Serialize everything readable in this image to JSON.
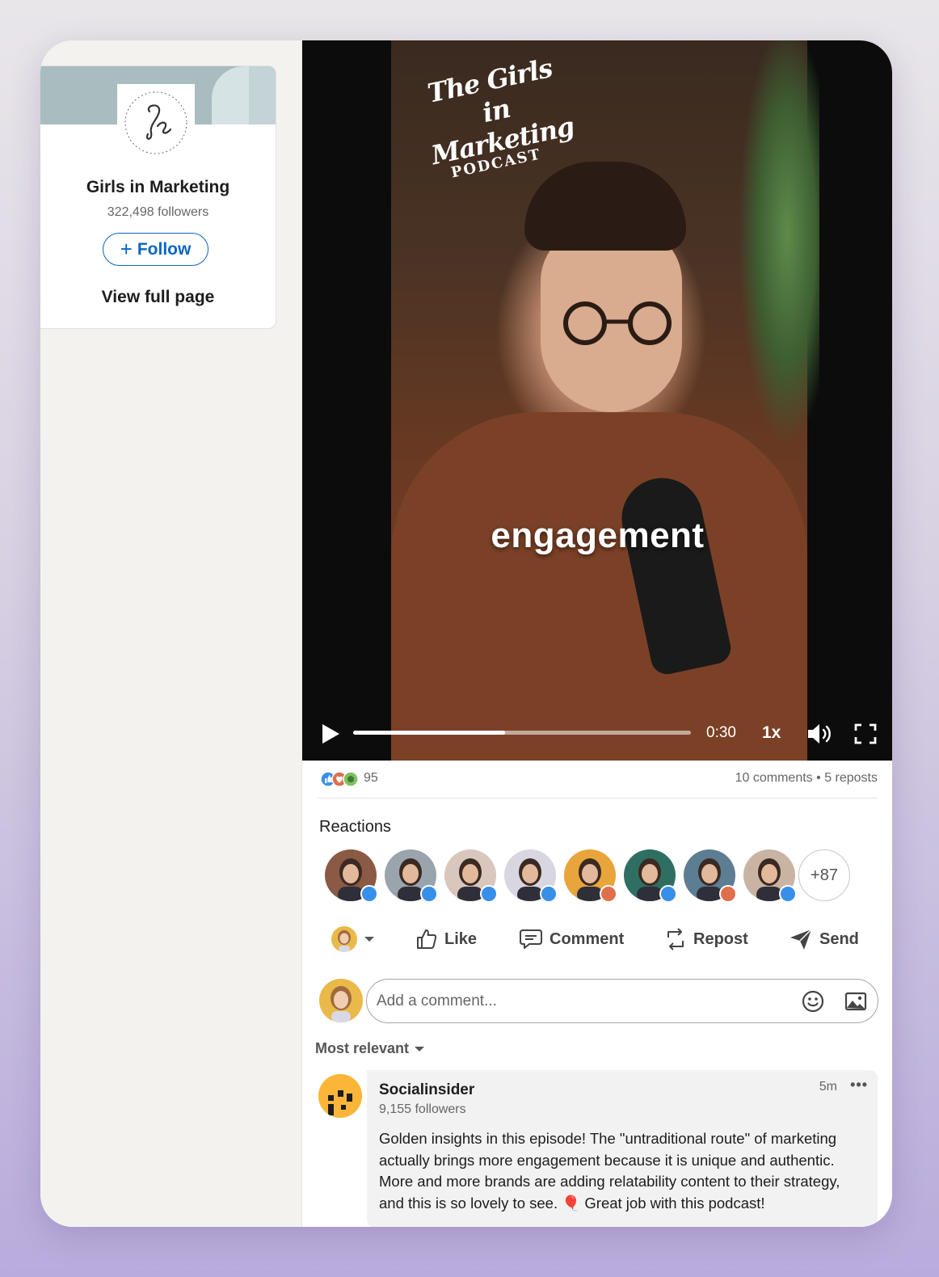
{
  "page": {
    "name": "Girls in Marketing",
    "followers": "322,498 followers",
    "follow_label": "Follow",
    "view_full_label": "View full page"
  },
  "video": {
    "brand_logo_line1": "The Girls in Marketing",
    "brand_logo_line2": "PODCAST",
    "caption": "engagement",
    "time": "0:30",
    "speed": "1x",
    "progress": 0.45
  },
  "social": {
    "reaction_count": "95",
    "comments": "10 comments",
    "separator": "•",
    "reposts": "5 reposts"
  },
  "reactions": {
    "title": "Reactions",
    "more_label": "+87",
    "avatars": [
      {
        "badge": "like",
        "color": "#8a5a44"
      },
      {
        "badge": "like",
        "color": "#9aa4ad"
      },
      {
        "badge": "like",
        "color": "#d9c7bd"
      },
      {
        "badge": "like",
        "color": "#d8d6e0"
      },
      {
        "badge": "love",
        "color": "#e8a53b"
      },
      {
        "badge": "like",
        "color": "#2f6f61"
      },
      {
        "badge": "love",
        "color": "#5d7d92"
      },
      {
        "badge": "like",
        "color": "#c9b4a4"
      }
    ]
  },
  "actions": {
    "like": "Like",
    "comment": "Comment",
    "repost": "Repost",
    "send": "Send"
  },
  "comment_box": {
    "placeholder": "Add a comment..."
  },
  "sort": {
    "label": "Most relevant"
  },
  "comment": {
    "author": "Socialinsider",
    "followers": "9,155 followers",
    "time": "5m",
    "more": "•••",
    "text": "Golden insights in this episode! The \"untraditional route\" of marketing actually brings more engagement because it is unique and authentic. More and more brands are adding relatability content to their strategy, and this is so lovely to see. 🎈 Great job with this podcast!"
  },
  "colors": {
    "accent": "#0a66c2",
    "like_badge": "#378fe9",
    "love_badge": "#df704d",
    "insight_badge": "#7fc15e"
  }
}
